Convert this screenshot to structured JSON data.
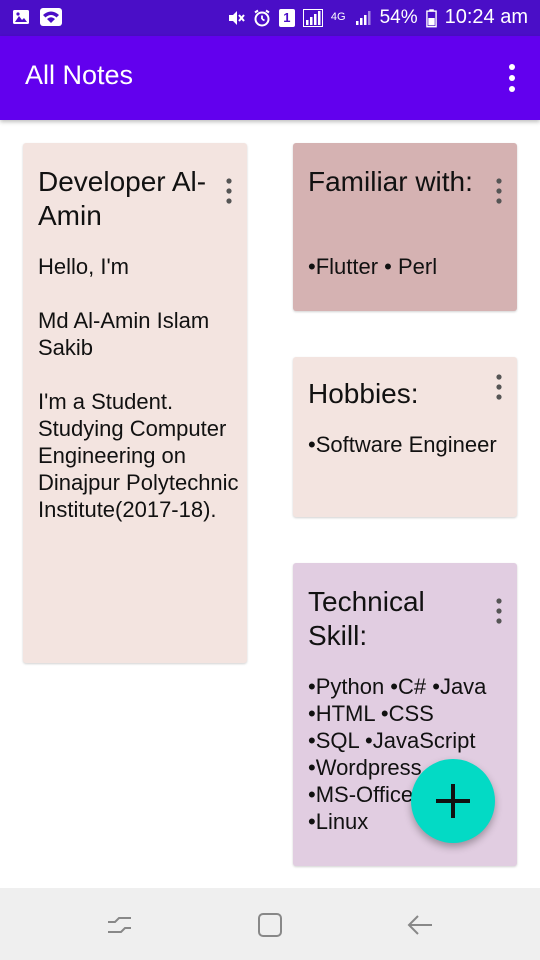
{
  "status_bar": {
    "network": "4G",
    "sim_slot": "1",
    "battery": "54%",
    "time": "10:24 am"
  },
  "app_bar": {
    "title": "All Notes",
    "menu_icon": "more-vert-icon"
  },
  "notes": [
    {
      "title": "Developer Al-Amin",
      "body": "Hello, I'm\n\nMd Al-Amin Islam Sakib\n\nI'm a Student. Studying Computer Engineering on Dinajpur Polytechnic Institute(2017-18).",
      "color": "#f3e4e0"
    },
    {
      "title": "Familiar with:",
      "body": "•Flutter • Perl",
      "color": "#d5b2b2"
    },
    {
      "title": "Hobbies:",
      "body": "•Software Engineer",
      "color": "#f3e4e0"
    },
    {
      "title": "Technical Skill:",
      "body": "•Python •C# •Java\n•HTML •CSS\n•SQL •JavaScript\n•Wordpress\n•MS-Office\n•Linux",
      "color": "#e1cde1"
    }
  ],
  "fab": {
    "icon": "add-icon",
    "color": "#03dac5"
  },
  "colors": {
    "app_bar": "#6200ee",
    "status_bar": "#4a0ec7"
  }
}
